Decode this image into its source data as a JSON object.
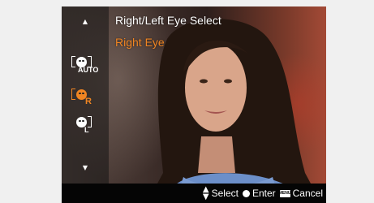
{
  "menu": {
    "title": "Right/Left Eye Select",
    "selected_value": "Right Eye",
    "options": [
      {
        "icon": "auto-eye-icon",
        "sub_label": "AUTO",
        "selected": false
      },
      {
        "icon": "right-eye-icon",
        "sub_label": "R",
        "selected": true
      },
      {
        "icon": "left-eye-icon",
        "sub_label": "L",
        "selected": false
      }
    ]
  },
  "guide": {
    "select_label": "Select",
    "enter_label": "Enter",
    "menu_key_label": "MENU",
    "cancel_label": "Cancel"
  },
  "colors": {
    "accent": "#f08522",
    "text": "#ffffff",
    "bar": "#050505"
  }
}
